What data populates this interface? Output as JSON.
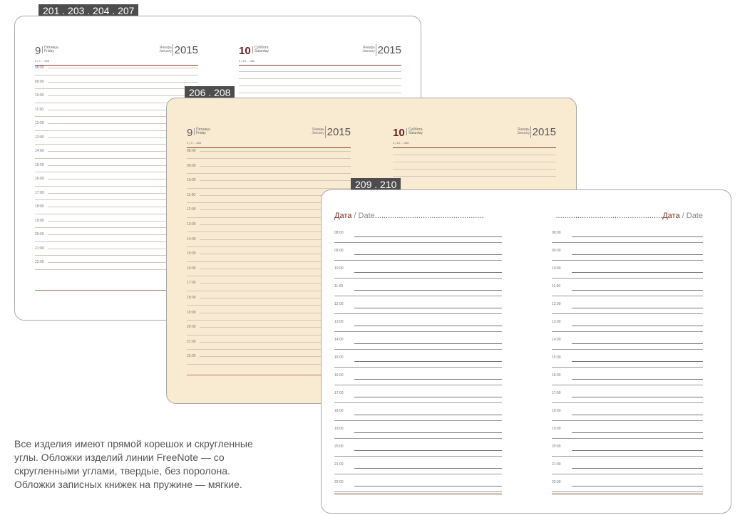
{
  "tags": [
    "201 . 203 . 204 . 207",
    "206 . 208",
    "209 . 210"
  ],
  "diary": {
    "left": {
      "day": "9",
      "day_ru": "Пятница",
      "day_en": "Friday",
      "count": "2 | 9 ... 356",
      "month_ru": "Январь",
      "month_en": "January",
      "year": "2015"
    },
    "right": {
      "day": "10",
      "day_ru": "Суббота",
      "day_en": "Saturday",
      "count": "2 | 10 ... 355",
      "month_ru": "Январь",
      "month_en": "January",
      "year": "2015"
    },
    "times": [
      "08:00",
      "09:00",
      "10:00",
      "11:00",
      "12:00",
      "13:00",
      "14:00",
      "15:00",
      "16:00",
      "17:00",
      "18:00",
      "19:00",
      "20:00",
      "21:00",
      "22:00"
    ]
  },
  "notebook": {
    "date_ru": "Дата",
    "date_sep": " / ",
    "date_en": "Date",
    "times": [
      "08:00",
      "09:00",
      "10:00",
      "11:00",
      "12:00",
      "13:00",
      "14:00",
      "15:00",
      "16:00",
      "17:00",
      "18:00",
      "19:00",
      "20:00",
      "21:00",
      "22:00"
    ]
  },
  "footer": "Все изделия имеют прямой корешок и скругленные углы. Обложки изделий линии FreeNote — со скругленными углами, твердые, без поролона. Обложки записных книжек на пружине — мягкие.",
  "colors": {
    "card2_bg": "#f9ead2",
    "accent": "#6b1f17",
    "rule": "#8a3a2a"
  }
}
